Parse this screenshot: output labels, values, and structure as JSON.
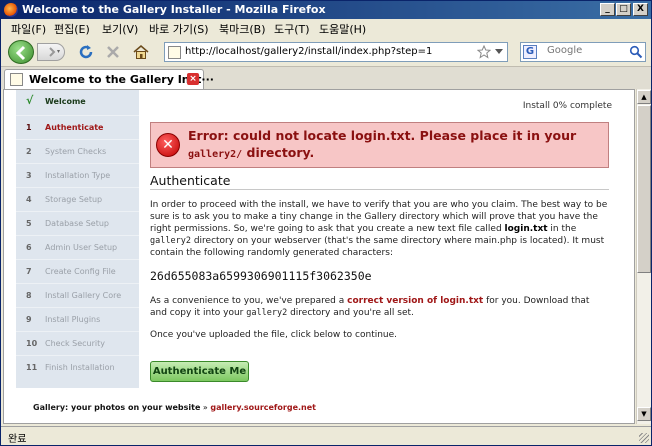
{
  "window": {
    "title": "Welcome to the Gallery Installer - Mozilla Firefox",
    "controls": {
      "minimize": "_",
      "maximize": "□",
      "close": "X"
    }
  },
  "menubar": {
    "items": [
      "파일(F)",
      "편집(E)",
      "보기(V)",
      "바로 가기(S)",
      "북마크(B)",
      "도구(T)",
      "도움말(H)"
    ]
  },
  "toolbar": {
    "url": "http://localhost/gallery2/install/index.php?step=1",
    "search_placeholder": "Google",
    "search_engine_icon": "G"
  },
  "tab": {
    "label": "Welcome to the Gallery Inst···",
    "close": "×"
  },
  "sidebar": {
    "steps": [
      {
        "num": "√",
        "label": "Welcome",
        "state": "done"
      },
      {
        "num": "1",
        "label": "Authenticate",
        "state": "active"
      },
      {
        "num": "2",
        "label": "System Checks",
        "state": "pending"
      },
      {
        "num": "3",
        "label": "Installation Type",
        "state": "pending"
      },
      {
        "num": "4",
        "label": "Storage Setup",
        "state": "pending"
      },
      {
        "num": "5",
        "label": "Database Setup",
        "state": "pending"
      },
      {
        "num": "6",
        "label": "Admin User Setup",
        "state": "pending"
      },
      {
        "num": "7",
        "label": "Create Config File",
        "state": "pending"
      },
      {
        "num": "8",
        "label": "Install Gallery Core",
        "state": "pending"
      },
      {
        "num": "9",
        "label": "Install Plugins",
        "state": "pending"
      },
      {
        "num": "10",
        "label": "Check Security",
        "state": "pending"
      },
      {
        "num": "11",
        "label": "Finish Installation",
        "state": "pending"
      }
    ]
  },
  "main": {
    "progress_text": "Install 0% complete",
    "progress_percent": 0,
    "error": {
      "prefix": "Error: could not locate login.txt. Please place it in your ",
      "dir": "gallery2/",
      "suffix": " directory."
    },
    "heading": "Authenticate",
    "para1": {
      "a": "In order to proceed with the install, we have to verify that you are who you claim. The best way to be sure is to ask you to make a tiny change in the Gallery directory which will prove that you have the right permissions. So, we're going to ask that you create a new text file called ",
      "file": "login.txt",
      "b": " in the ",
      "dir": "gallery2",
      "c": " directory on your webserver (that's the same directory where main.php is located). It must contain the following randomly generated characters:"
    },
    "hash": "26d655083a6599306901115f3062350e",
    "para2": {
      "a": "As a convenience to you, we've prepared a ",
      "link": "correct version of login.txt",
      "b": " for you. Download that and copy it into your ",
      "dir": "gallery2",
      "c": " directory and you're all set."
    },
    "para3": "Once you've uploaded the file, click below to continue.",
    "button": "Authenticate Me"
  },
  "footer": {
    "brand": "Gallery: ",
    "tagline": "your photos on your website",
    "sep": " » ",
    "link": "gallery.sourceforge.net"
  },
  "status": {
    "text": "완료"
  },
  "colors": {
    "error_bg": "#f7c6c6",
    "active_step": "#a01818",
    "sidebar_bg": "#dfe6ee",
    "button_green": "#7cc860"
  }
}
